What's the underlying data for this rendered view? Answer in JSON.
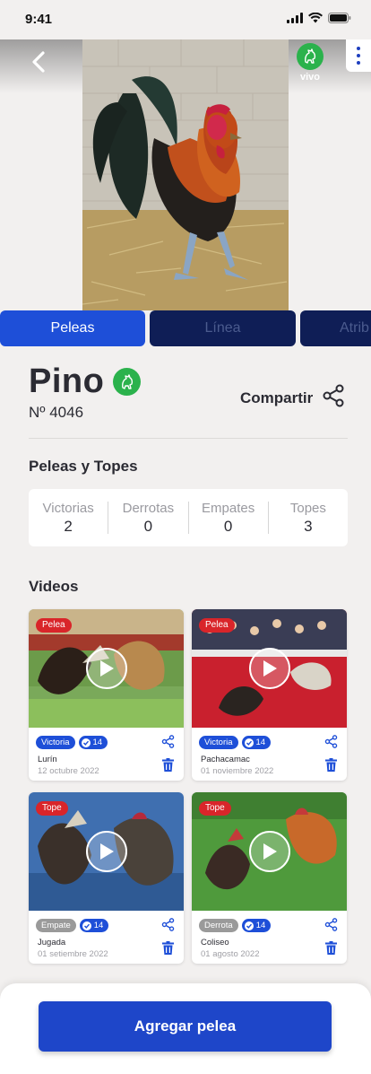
{
  "status_bar": {
    "time": "9:41"
  },
  "header": {
    "status_label": "vivo",
    "colors": {
      "alive": "#2bb24c",
      "primary": "#1e4fd8"
    }
  },
  "tabs": [
    {
      "label": "Peleas",
      "active": true
    },
    {
      "label": "Línea",
      "active": false
    },
    {
      "label": "Atrib",
      "active": false
    }
  ],
  "profile": {
    "name": "Pino",
    "number": "Nº 4046",
    "share_label": "Compartir"
  },
  "stats_section": {
    "title": "Peleas y Topes",
    "items": [
      {
        "label": "Victorias",
        "value": "2"
      },
      {
        "label": "Derrotas",
        "value": "0"
      },
      {
        "label": "Empates",
        "value": "0"
      },
      {
        "label": "Topes",
        "value": "3"
      }
    ]
  },
  "videos_section": {
    "title": "Videos",
    "items": [
      {
        "type": "Pelea",
        "result": "Victoria",
        "count": "14",
        "place": "Lurín",
        "date": "12 octubre 2022"
      },
      {
        "type": "Pelea",
        "result": "Victoria",
        "count": "14",
        "place": "Pachacamac",
        "date": "01 noviembre 2022"
      },
      {
        "type": "Tope",
        "result": "Empate",
        "count": "14",
        "place": "Jugada",
        "date": "01 setiembre 2022"
      },
      {
        "type": "Tope",
        "result": "Derrota",
        "count": "14",
        "place": "Coliseo",
        "date": "01 agosto 2022"
      }
    ]
  },
  "footer": {
    "add_button": "Agregar pelea"
  }
}
